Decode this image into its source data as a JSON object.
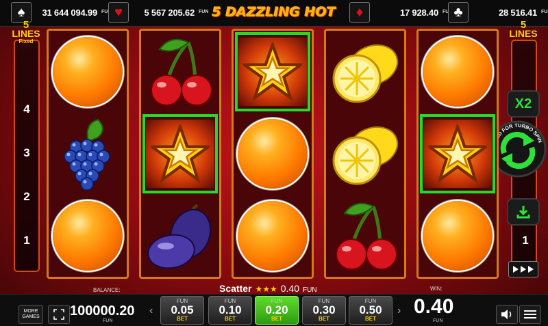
{
  "title": "5 DAZZLING HOT",
  "jackpots": [
    {
      "suit": "spade-icon",
      "glyph": "♠",
      "color": "#ffffff",
      "amount": "31 644 094.99",
      "unit": "FUN"
    },
    {
      "suit": "heart-icon",
      "glyph": "♥",
      "color": "#e0101a",
      "amount": "5 567 205.62",
      "unit": "FUN"
    },
    {
      "suit": "diamond-icon",
      "glyph": "♦",
      "color": "#e0101a",
      "amount": "17 928.40",
      "unit": "FUN"
    },
    {
      "suit": "club-icon",
      "glyph": "♣",
      "color": "#ffffff",
      "amount": "28 516.41",
      "unit": "FUN"
    }
  ],
  "lines": {
    "count": "5",
    "label": "LINES",
    "sub": "Fixed",
    "left_numbers": [
      "4",
      "3",
      "2",
      "1"
    ],
    "right_numbers": [
      "1"
    ]
  },
  "side_controls": {
    "multiplier": "X2",
    "turbo": "HOLD FOR TURBO SPIN"
  },
  "reels": [
    [
      "orange",
      "grapes",
      "orange"
    ],
    [
      "cherry",
      "star",
      "plum"
    ],
    [
      "star",
      "orange",
      "orange"
    ],
    [
      "lemon",
      "lemon",
      "cherry"
    ],
    [
      "orange",
      "star",
      "orange"
    ]
  ],
  "winning_cells": [
    [
      1,
      1
    ],
    [
      2,
      0
    ],
    [
      4,
      1
    ]
  ],
  "scatter": {
    "label": "Scatter",
    "stars": "★★★",
    "amount": "0.40",
    "unit": "FUN"
  },
  "balance": {
    "label": "BALANCE:",
    "value": "100000.20",
    "unit": "FUN"
  },
  "win": {
    "label": "WIN:",
    "value": "0.40",
    "unit": "FUN"
  },
  "more_games": "MORE GAMES",
  "bets": [
    {
      "currency": "FUN",
      "value": "0.05",
      "label": "BET",
      "selected": false
    },
    {
      "currency": "FUN",
      "value": "0.10",
      "label": "BET",
      "selected": false
    },
    {
      "currency": "FUN",
      "value": "0.20",
      "label": "BET",
      "selected": true
    },
    {
      "currency": "FUN",
      "value": "0.30",
      "label": "BET",
      "selected": false
    },
    {
      "currency": "FUN",
      "value": "0.50",
      "label": "BET",
      "selected": false
    }
  ],
  "colors": {
    "reel_border": "#d47a16",
    "win_frame": "#1fdc2a",
    "accent": "#ffd000"
  }
}
